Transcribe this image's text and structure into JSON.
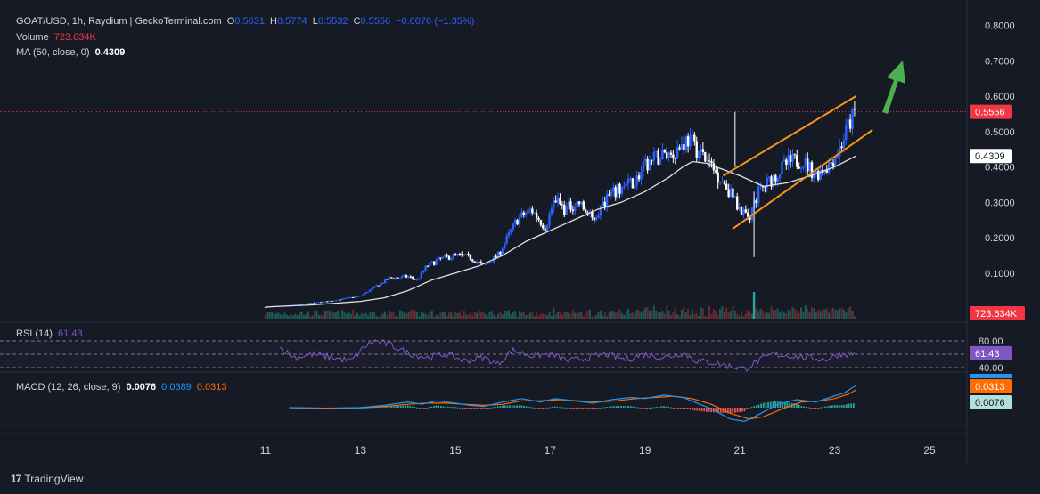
{
  "header": {
    "symbol": "GOAT/USD, 1h, Raydium | GeckoTerminal.com",
    "o_key": "O",
    "o": "0.5631",
    "h_key": "H",
    "h": "0.5774",
    "l_key": "L",
    "l": "0.5532",
    "c_key": "C",
    "c": "0.5556",
    "change": "−0.0076 (−1.35%)",
    "volume_label": "Volume",
    "volume_value": "723.634K",
    "ma_label": "MA (50, close, 0)",
    "ma_value": "0.4309",
    "rsi_label": "RSI (14)",
    "rsi_value": "61.43",
    "macd_label": "MACD (12, 26, close, 9)",
    "macd_value": "0.0076",
    "macd_line": "0.0389",
    "macd_signal": "0.0313"
  },
  "branding": {
    "text": "TradingView",
    "logo": "17"
  },
  "colors": {
    "background": "#161a25",
    "up": "#2962ff",
    "down": "#ffffff",
    "ma": "#e0e0e0",
    "channel": "#f7931a",
    "arrow": "#4caf50",
    "price_tag": "#f23645",
    "rsi": "#7e57c2",
    "macd": "#2196f3",
    "signal": "#ff6d00",
    "hist_pos": "#26a69a",
    "hist_neg": "#ef5350"
  },
  "chart_data": [
    {
      "type": "candlestick",
      "title": "GOAT/USD, 1h, Raydium | GeckoTerminal.com",
      "x_ticks": [
        "11",
        "13",
        "15",
        "17",
        "19",
        "21",
        "23",
        "25"
      ],
      "x_tick_values": [
        11,
        13,
        15,
        17,
        19,
        21,
        23,
        25
      ],
      "y_ticks": [
        "0.1000",
        "0.2000",
        "0.3000",
        "0.4000",
        "0.5000",
        "0.6000",
        "0.7000",
        "0.8000"
      ],
      "y_tick_values": [
        0.1,
        0.2,
        0.3,
        0.4,
        0.5,
        0.6,
        0.7,
        0.8
      ],
      "ylim": [
        0.0,
        0.8
      ],
      "xlim": [
        10,
        26
      ],
      "last_price_label": "0.5556",
      "last_price": 0.5556,
      "ma_label": "0.4309",
      "ma_last": 0.4309,
      "close_path": [
        [
          11.0,
          0.004
        ],
        [
          11.6,
          0.01
        ],
        [
          12.3,
          0.02
        ],
        [
          13.0,
          0.035
        ],
        [
          13.3,
          0.06
        ],
        [
          13.6,
          0.085
        ],
        [
          14.0,
          0.09
        ],
        [
          14.2,
          0.08
        ],
        [
          14.4,
          0.12
        ],
        [
          14.7,
          0.14
        ],
        [
          15.0,
          0.15
        ],
        [
          15.3,
          0.145
        ],
        [
          15.6,
          0.12
        ],
        [
          15.9,
          0.15
        ],
        [
          16.1,
          0.2
        ],
        [
          16.3,
          0.25
        ],
        [
          16.6,
          0.28
        ],
        [
          16.9,
          0.23
        ],
        [
          17.1,
          0.31
        ],
        [
          17.3,
          0.28
        ],
        [
          17.6,
          0.3
        ],
        [
          17.9,
          0.25
        ],
        [
          18.2,
          0.31
        ],
        [
          18.5,
          0.34
        ],
        [
          18.8,
          0.36
        ],
        [
          19.0,
          0.4
        ],
        [
          19.3,
          0.43
        ],
        [
          19.6,
          0.44
        ],
        [
          19.9,
          0.48
        ],
        [
          20.1,
          0.45
        ],
        [
          20.4,
          0.4
        ],
        [
          20.7,
          0.35
        ],
        [
          21.0,
          0.28
        ],
        [
          21.2,
          0.26
        ],
        [
          21.4,
          0.33
        ],
        [
          21.7,
          0.37
        ],
        [
          22.0,
          0.41
        ],
        [
          22.3,
          0.42
        ],
        [
          22.6,
          0.38
        ],
        [
          22.9,
          0.41
        ],
        [
          23.1,
          0.45
        ],
        [
          23.3,
          0.52
        ],
        [
          23.45,
          0.556
        ]
      ],
      "ma_path": [
        [
          11.0,
          0.004
        ],
        [
          12.0,
          0.01
        ],
        [
          13.0,
          0.02
        ],
        [
          13.5,
          0.03
        ],
        [
          14.0,
          0.05
        ],
        [
          14.5,
          0.08
        ],
        [
          15.0,
          0.1
        ],
        [
          15.5,
          0.12
        ],
        [
          16.0,
          0.15
        ],
        [
          16.5,
          0.19
        ],
        [
          17.0,
          0.22
        ],
        [
          17.5,
          0.25
        ],
        [
          18.0,
          0.28
        ],
        [
          18.5,
          0.3
        ],
        [
          19.0,
          0.33
        ],
        [
          19.5,
          0.37
        ],
        [
          19.8,
          0.4
        ],
        [
          20.0,
          0.415
        ],
        [
          20.3,
          0.41
        ],
        [
          20.6,
          0.395
        ],
        [
          21.0,
          0.375
        ],
        [
          21.5,
          0.345
        ],
        [
          22.0,
          0.355
        ],
        [
          22.5,
          0.375
        ],
        [
          23.0,
          0.4
        ],
        [
          23.45,
          0.431
        ]
      ],
      "channel_upper": [
        [
          20.65,
          0.375
        ],
        [
          23.45,
          0.6
        ]
      ],
      "channel_lower": [
        [
          20.85,
          0.225
        ],
        [
          23.8,
          0.505
        ]
      ],
      "spike_low": [
        21.3,
        0.145
      ],
      "spike_high": [
        20.9,
        0.555
      ]
    },
    {
      "type": "line",
      "title": "RSI (14)",
      "y_ticks": [
        "80.00",
        "40.00"
      ],
      "y_tick_values": [
        80,
        40
      ],
      "ylim": [
        20,
        90
      ],
      "last_value_label": "61.43",
      "last_value": 61.43,
      "path": [
        [
          11.3,
          70
        ],
        [
          11.6,
          55
        ],
        [
          12.0,
          60
        ],
        [
          12.4,
          55
        ],
        [
          12.8,
          50
        ],
        [
          13.1,
          72
        ],
        [
          13.3,
          80
        ],
        [
          13.6,
          75
        ],
        [
          14.0,
          62
        ],
        [
          14.4,
          55
        ],
        [
          14.8,
          60
        ],
        [
          15.2,
          50
        ],
        [
          15.6,
          55
        ],
        [
          15.9,
          45
        ],
        [
          16.2,
          66
        ],
        [
          16.6,
          58
        ],
        [
          17.0,
          60
        ],
        [
          17.4,
          50
        ],
        [
          17.8,
          55
        ],
        [
          18.2,
          60
        ],
        [
          18.6,
          52
        ],
        [
          19.0,
          60
        ],
        [
          19.4,
          55
        ],
        [
          19.8,
          62
        ],
        [
          20.1,
          50
        ],
        [
          20.4,
          48
        ],
        [
          20.8,
          42
        ],
        [
          21.1,
          38
        ],
        [
          21.4,
          50
        ],
        [
          21.7,
          60
        ],
        [
          22.0,
          58
        ],
        [
          22.4,
          55
        ],
        [
          22.8,
          52
        ],
        [
          23.1,
          60
        ],
        [
          23.45,
          61.43
        ]
      ]
    },
    {
      "type": "line",
      "title": "MACD (12, 26, close, 9)",
      "ylim": [
        -0.04,
        0.04
      ],
      "macd_label": "0.0389",
      "signal_label": "0.0313",
      "hist_label": "0.0076",
      "macd_last": 0.0389,
      "signal_last": 0.0313,
      "hist_last": 0.0076,
      "macd_path": [
        [
          11.5,
          0.0
        ],
        [
          12.3,
          -0.002
        ],
        [
          13.0,
          0.0
        ],
        [
          13.5,
          0.004
        ],
        [
          14.0,
          0.01
        ],
        [
          14.3,
          0.006
        ],
        [
          14.6,
          0.012
        ],
        [
          15.0,
          0.008
        ],
        [
          15.3,
          0.004
        ],
        [
          15.6,
          0.002
        ],
        [
          16.0,
          0.01
        ],
        [
          16.4,
          0.016
        ],
        [
          16.8,
          0.01
        ],
        [
          17.1,
          0.016
        ],
        [
          17.5,
          0.012
        ],
        [
          17.9,
          0.008
        ],
        [
          18.3,
          0.014
        ],
        [
          18.7,
          0.018
        ],
        [
          19.0,
          0.016
        ],
        [
          19.4,
          0.022
        ],
        [
          19.8,
          0.018
        ],
        [
          20.1,
          0.008
        ],
        [
          20.4,
          -0.002
        ],
        [
          20.8,
          -0.02
        ],
        [
          21.1,
          -0.024
        ],
        [
          21.4,
          -0.012
        ],
        [
          21.8,
          0.006
        ],
        [
          22.2,
          0.014
        ],
        [
          22.6,
          0.01
        ],
        [
          22.9,
          0.018
        ],
        [
          23.2,
          0.026
        ],
        [
          23.45,
          0.0389
        ]
      ],
      "signal_path": [
        [
          11.5,
          0.0
        ],
        [
          12.3,
          -0.001
        ],
        [
          13.0,
          0.0
        ],
        [
          13.5,
          0.002
        ],
        [
          14.0,
          0.006
        ],
        [
          14.4,
          0.008
        ],
        [
          14.8,
          0.008
        ],
        [
          15.2,
          0.006
        ],
        [
          15.6,
          0.004
        ],
        [
          16.0,
          0.006
        ],
        [
          16.4,
          0.012
        ],
        [
          16.8,
          0.012
        ],
        [
          17.2,
          0.014
        ],
        [
          17.6,
          0.012
        ],
        [
          18.0,
          0.01
        ],
        [
          18.4,
          0.012
        ],
        [
          18.8,
          0.016
        ],
        [
          19.2,
          0.018
        ],
        [
          19.6,
          0.02
        ],
        [
          20.0,
          0.016
        ],
        [
          20.4,
          0.006
        ],
        [
          20.8,
          -0.01
        ],
        [
          21.2,
          -0.02
        ],
        [
          21.5,
          -0.016
        ],
        [
          21.9,
          -0.002
        ],
        [
          22.3,
          0.01
        ],
        [
          22.7,
          0.012
        ],
        [
          23.0,
          0.016
        ],
        [
          23.3,
          0.024
        ],
        [
          23.45,
          0.0313
        ]
      ]
    }
  ]
}
